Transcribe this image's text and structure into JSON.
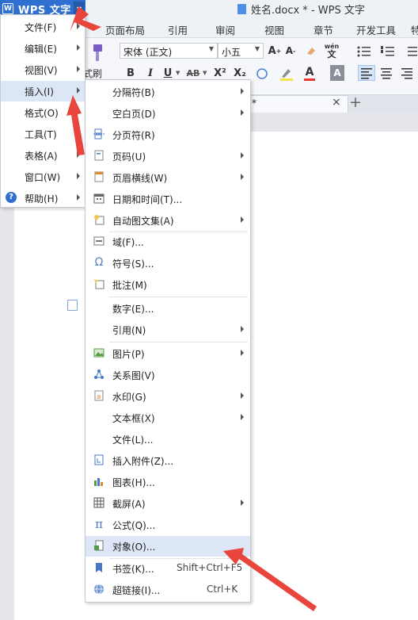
{
  "app": {
    "name": "WPS 文字",
    "logo_letter": "W",
    "window_title": "姓名.docx * - WPS 文字"
  },
  "ribbon_tabs": [
    "页面布局",
    "引用",
    "审阅",
    "视图",
    "章节",
    "开发工具",
    "特"
  ],
  "ribbon": {
    "font_name": "宋体 (正文)",
    "font_size": "小五",
    "format_brush_label": "式刷",
    "bold": "B",
    "italic": "I",
    "underline": "U",
    "strikethrough": "AB",
    "superscript": "X²",
    "subscript": "X₂",
    "text_color_letter": "A",
    "pinyin_label": "wén"
  },
  "document_tab": {
    "star": "*",
    "close": "×",
    "new_tab": "+"
  },
  "main_menu": [
    {
      "label": "文件(F)",
      "submenu": true
    },
    {
      "label": "编辑(E)",
      "submenu": true
    },
    {
      "label": "视图(V)",
      "submenu": true
    },
    {
      "label": "插入(I)",
      "submenu": true,
      "highlighted": true
    },
    {
      "label": "格式(O)",
      "submenu": true
    },
    {
      "label": "工具(T)",
      "submenu": true
    },
    {
      "label": "表格(A)",
      "submenu": true
    },
    {
      "label": "窗口(W)",
      "submenu": true
    },
    {
      "label": "帮助(H)",
      "submenu": true,
      "icon": "help-icon",
      "icon_glyph": "?"
    }
  ],
  "insert_menu": [
    {
      "label": "分隔符(B)",
      "submenu": true,
      "icon": ""
    },
    {
      "label": "空白页(D)",
      "submenu": true,
      "icon": ""
    },
    {
      "label": "分页符(R)",
      "submenu": false,
      "icon": "page-break-icon"
    },
    {
      "label": "页码(U)",
      "submenu": true,
      "icon": "page-number-icon"
    },
    {
      "label": "页眉横线(W)",
      "submenu": true,
      "icon": "header-line-icon"
    },
    {
      "label": "日期和时间(T)...",
      "submenu": false,
      "icon": "calendar-icon"
    },
    {
      "label": "自动图文集(A)",
      "submenu": true,
      "icon": "autotext-icon"
    },
    {
      "label": "域(F)...",
      "submenu": false,
      "icon": "field-icon"
    },
    {
      "label": "符号(S)...",
      "submenu": false,
      "icon": "omega-icon",
      "icon_glyph": "Ω"
    },
    {
      "label": "批注(M)",
      "submenu": false,
      "icon": "comment-icon"
    },
    {
      "label": "数字(E)...",
      "submenu": false,
      "icon": ""
    },
    {
      "label": "引用(N)",
      "submenu": true,
      "icon": ""
    },
    {
      "label": "图片(P)",
      "submenu": true,
      "icon": "picture-icon"
    },
    {
      "label": "关系图(V)",
      "submenu": false,
      "icon": "relation-diagram-icon"
    },
    {
      "label": "水印(G)",
      "submenu": true,
      "icon": "watermark-icon"
    },
    {
      "label": "文本框(X)",
      "submenu": true,
      "icon": ""
    },
    {
      "label": "文件(L)...",
      "submenu": false,
      "icon": ""
    },
    {
      "label": "插入附件(Z)...",
      "submenu": false,
      "icon": "attachment-icon"
    },
    {
      "label": "图表(H)...",
      "submenu": false,
      "icon": "chart-icon"
    },
    {
      "label": "截屏(A)",
      "submenu": true,
      "icon": "screenshot-icon"
    },
    {
      "label": "公式(Q)...",
      "submenu": false,
      "icon": "pi-icon",
      "icon_glyph": "π"
    },
    {
      "label": "对象(O)...",
      "submenu": false,
      "icon": "object-icon",
      "highlighted": true
    },
    {
      "label": "书签(K)...",
      "submenu": false,
      "icon": "bookmark-icon",
      "shortcut": "Shift+Ctrl+F5"
    },
    {
      "label": "超链接(I)...",
      "submenu": false,
      "icon": "hyperlink-icon",
      "shortcut": "Ctrl+K"
    }
  ],
  "colors": {
    "wps_blue": "#2f6fcf",
    "highlight": "#dce6f6",
    "annotation_arrow": "#e8453c"
  }
}
